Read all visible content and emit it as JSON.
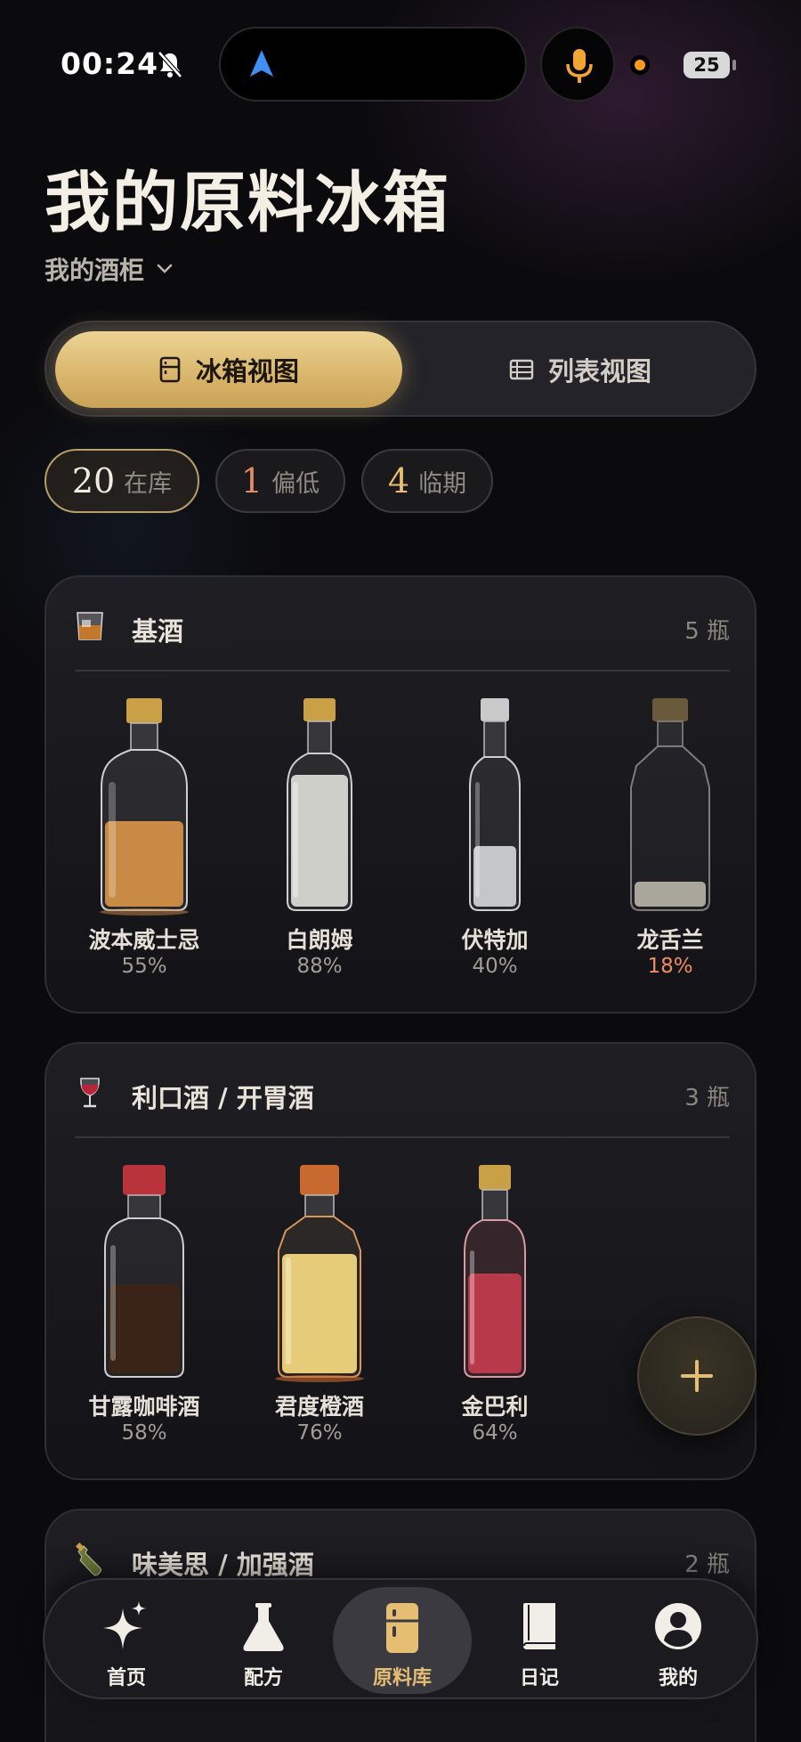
{
  "status_bar": {
    "time": "00:24",
    "battery": "25"
  },
  "header": {
    "title": "我的原料冰箱",
    "cabinet": "我的酒柜"
  },
  "view_toggle": {
    "fridge_label": "冰箱视图",
    "list_label": "列表视图",
    "active": "fridge"
  },
  "stats": {
    "in_stock": {
      "value": "20",
      "label": "在库"
    },
    "low": {
      "value": "1",
      "label": "偏低"
    },
    "expiring": {
      "value": "4",
      "label": "临期"
    }
  },
  "sections": [
    {
      "title": "基酒",
      "count": "5 瓶",
      "icon": "whisky-glass-icon",
      "bottles": [
        {
          "name": "波本威士忌",
          "level": "55%",
          "level_value": 0.55,
          "liquid": "#c98a45",
          "cap": "#c9a046"
        },
        {
          "name": "白朗姆",
          "level": "88%",
          "level_value": 0.88,
          "liquid": "#cfcfca",
          "cap": "#c9a046"
        },
        {
          "name": "伏特加",
          "level": "40%",
          "level_value": 0.4,
          "liquid": "#c4c6c9",
          "cap": "#c9c9c9"
        },
        {
          "name": "龙舌兰",
          "level": "18%",
          "level_value": 0.18,
          "liquid": "#d8d4c4",
          "cap": "#6a5a3c",
          "warn": true
        }
      ]
    },
    {
      "title": "利口酒 / 开胃酒",
      "count": "3 瓶",
      "icon": "wine-glass-icon",
      "bottles": [
        {
          "name": "甘露咖啡酒",
          "level": "58%",
          "level_value": 0.58,
          "liquid": "#3a2418",
          "cap": "#b8343a"
        },
        {
          "name": "君度橙酒",
          "level": "76%",
          "level_value": 0.76,
          "liquid": "#e6cc78",
          "cap": "#c86a30"
        },
        {
          "name": "金巴利",
          "level": "64%",
          "level_value": 0.64,
          "liquid": "#b83a4a",
          "cap": "#c9a046"
        }
      ]
    },
    {
      "title": "味美思 / 加强酒",
      "count": "2 瓶",
      "icon": "bottle-icon",
      "bottles": []
    }
  ],
  "tab_bar": {
    "tabs": [
      {
        "label": "首页",
        "icon": "sparkle-icon"
      },
      {
        "label": "配方",
        "icon": "flask-icon"
      },
      {
        "label": "原料库",
        "icon": "fridge-icon",
        "active": true
      },
      {
        "label": "日记",
        "icon": "book-icon"
      },
      {
        "label": "我的",
        "icon": "profile-icon"
      }
    ]
  },
  "colors": {
    "accent": "#e5be74",
    "warn": "#ef8b63",
    "background": "#0b0b0e"
  }
}
